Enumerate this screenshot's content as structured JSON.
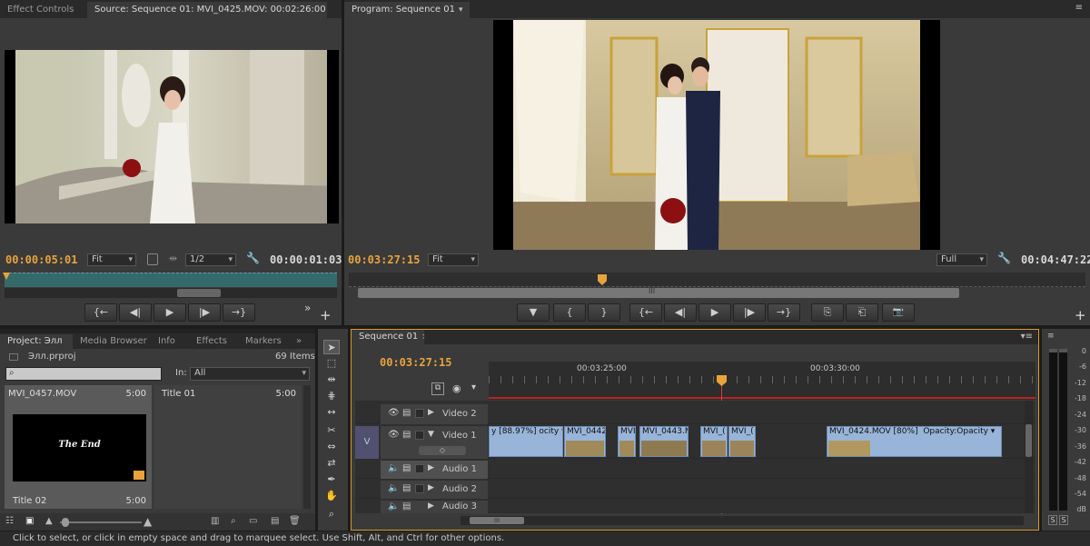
{
  "source": {
    "tabs": [
      "Effect Controls",
      "Source: Sequence 01: MVI_0425.MOV: 00:02:26:00"
    ],
    "timecode_left": "00:00:05:01",
    "fit": "Fit",
    "resolution": "1/2",
    "timecode_right": "00:00:01:03",
    "buttons": [
      "{←",
      "◀|",
      "▶",
      "|▶",
      "→}"
    ],
    "more": "»",
    "add": "+"
  },
  "program": {
    "tab": "Program: Sequence 01",
    "timecode_left": "00:03:27:15",
    "fit": "Fit",
    "quality": "Full",
    "timecode_right": "00:04:47:22",
    "scrub_label": "III",
    "buttons": [
      "▼",
      "{",
      "}",
      "{←",
      "◀|",
      "▶",
      "|▶",
      "→}",
      "⎘",
      "⎗",
      "📷"
    ],
    "add": "+"
  },
  "project": {
    "tabs": [
      "Project: Элл",
      "Media Browser",
      "Info",
      "Effects",
      "Markers"
    ],
    "more": "»",
    "file": "Элл.prproj",
    "items_count": "69 Items",
    "search_placeholder": "",
    "in_label": "In:",
    "in_value": "All",
    "items": [
      {
        "name": "MVI_0457.MOV",
        "duration": "5:00"
      },
      {
        "name": "Title 01",
        "duration": "5:00"
      },
      {
        "name": "Title 02",
        "duration": "5:00"
      }
    ],
    "thumb_text": "The End"
  },
  "sequence": {
    "tab": "Sequence 01",
    "timecode": "00:03:27:15",
    "ruler": [
      "00:03:25:00",
      "00:03:30:00"
    ],
    "tracks": [
      {
        "name": "Video 2"
      },
      {
        "name": "Video 1"
      },
      {
        "name": "Audio 1"
      },
      {
        "name": "Audio 2"
      },
      {
        "name": "Audio 3"
      }
    ],
    "track_target": "V",
    "scroll_label": "III",
    "clips": [
      {
        "label": "y [88.97%]"
      },
      {
        "label": "ocity ▾"
      },
      {
        "label": "MVI_0442"
      },
      {
        "label": "MVI"
      },
      {
        "label": "MVI_0443.M"
      },
      {
        "label": "MVI_("
      },
      {
        "label": "MVI_("
      },
      {
        "label": "MVI_0424.MOV [80%]"
      },
      {
        "label": "Opacity:Opacity ▾"
      }
    ]
  },
  "meter": {
    "labels": [
      "0",
      "-6",
      "-12",
      "-18",
      "-24",
      "-30",
      "-36",
      "-42",
      "-48",
      "-54",
      "dB"
    ],
    "solo": [
      "S",
      "S"
    ]
  },
  "status_bar": "Click to select, or click in empty space and drag to marquee select. Use Shift, Alt, and Ctrl for other options.",
  "colors": {
    "accent_timecode": "#e8a33c",
    "clip_fill": "#98b4d8",
    "playhead": "#e03c31",
    "panel": "#3a3a3a"
  },
  "icons": [
    "eye-icon",
    "film-icon",
    "speaker-icon",
    "wrench-icon",
    "camera-icon",
    "search-icon",
    "selection-tool-icon",
    "razor-tool-icon",
    "hand-tool-icon",
    "zoom-tool-icon"
  ]
}
